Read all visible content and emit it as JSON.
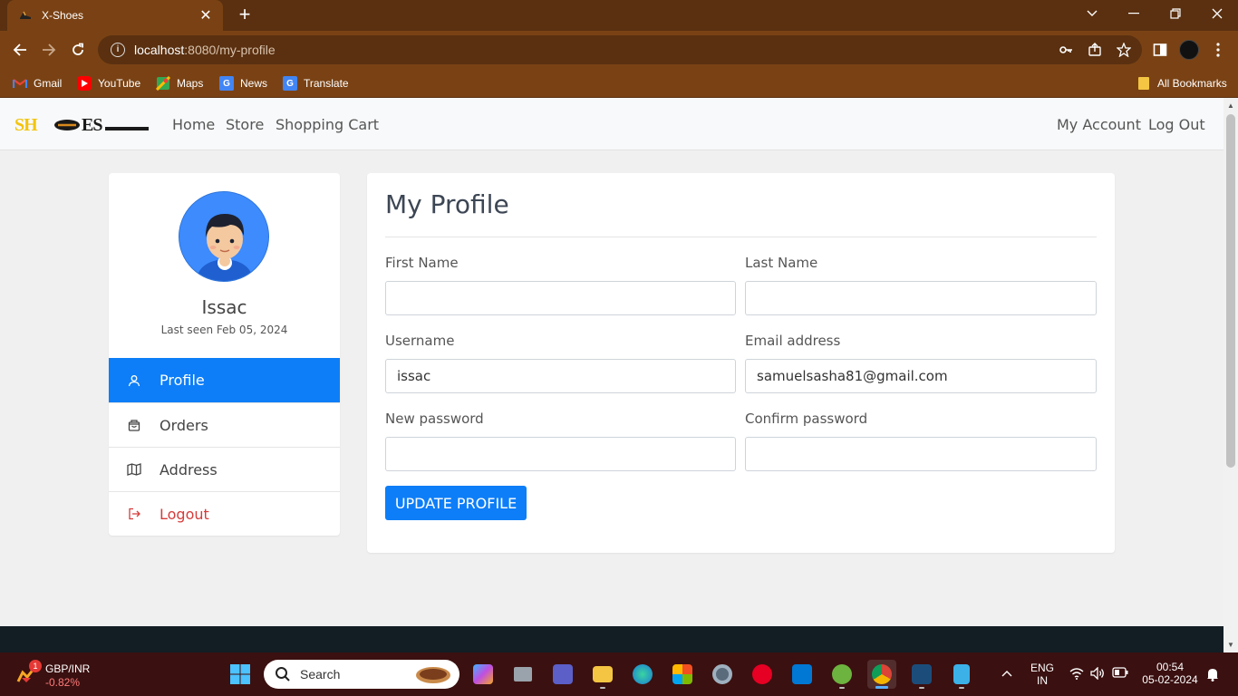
{
  "browser": {
    "tab_title": "X-Shoes",
    "tab_close": "✕",
    "new_tab": "+",
    "url_host": "localhost",
    "url_path": ":8080/my-profile",
    "bookmarks": [
      {
        "label": "Gmail",
        "icon": "gmail-icon",
        "color": "#ea4335"
      },
      {
        "label": "YouTube",
        "icon": "youtube-icon",
        "color": "#ff0000"
      },
      {
        "label": "Maps",
        "icon": "maps-icon",
        "color": "#34a853"
      },
      {
        "label": "News",
        "icon": "news-icon",
        "color": "#4285f4"
      },
      {
        "label": "Translate",
        "icon": "translate-icon",
        "color": "#4285f4"
      }
    ],
    "all_bookmarks": "All Bookmarks"
  },
  "navbar": {
    "brand": "SHOES",
    "links": [
      "Home",
      "Store",
      "Shopping Cart"
    ],
    "right_links": [
      "My Account",
      "Log Out"
    ]
  },
  "sidebar": {
    "user_name": "Issac",
    "last_seen": "Last seen Feb 05, 2024",
    "items": [
      {
        "label": "Profile",
        "icon": "user-icon"
      },
      {
        "label": "Orders",
        "icon": "bag-icon"
      },
      {
        "label": "Address",
        "icon": "map-icon"
      },
      {
        "label": "Logout",
        "icon": "logout-icon"
      }
    ],
    "active_color": "#0d7ef7",
    "logout_color": "#d63b3b"
  },
  "profile_form": {
    "title": "My Profile",
    "first_name_label": "First Name",
    "first_name_value": "",
    "last_name_label": "Last Name",
    "last_name_value": "",
    "username_label": "Username",
    "username_value": "issac",
    "email_label": "Email address",
    "email_value": "samuelsasha81@gmail.com",
    "new_password_label": "New password",
    "new_password_value": "",
    "confirm_password_label": "Confirm password",
    "confirm_password_value": "",
    "submit_label": "UPDATE PROFILE"
  },
  "taskbar": {
    "weather_badge": "1",
    "ticker_name": "GBP/INR",
    "ticker_change": "-0.82%",
    "search_placeholder": "Search",
    "lang_line1": "ENG",
    "lang_line2": "IN",
    "time": "00:54",
    "date": "05-02-2024"
  }
}
